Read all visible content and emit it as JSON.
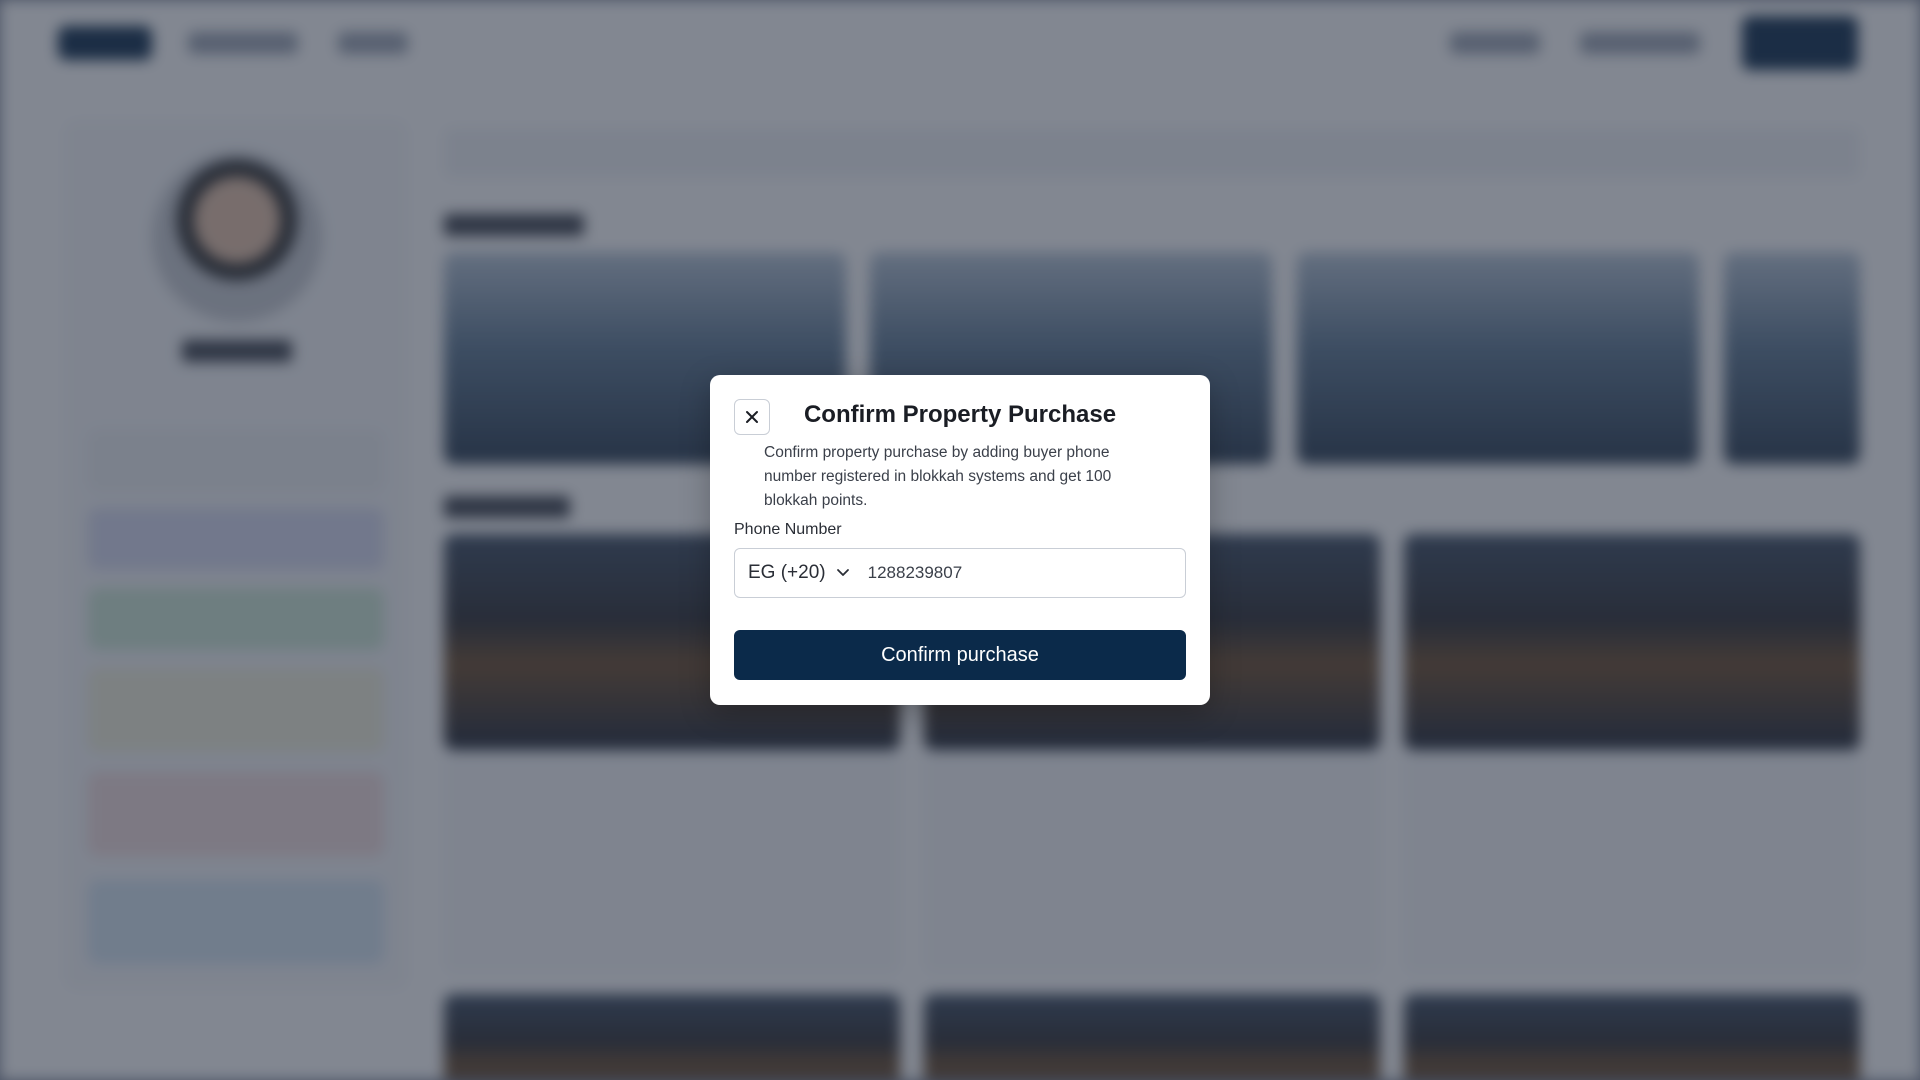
{
  "modal": {
    "title": "Confirm Property Purchase",
    "description": "Confirm property purchase by adding buyer phone number registered in blokkah systems and get 100  blokkah points.",
    "close_icon": "close-icon",
    "phone": {
      "label": "Phone Number",
      "country_code": "EG (+20)",
      "value": "1288239807",
      "dropdown_icon": "chevron-down-icon"
    },
    "confirm_label": "Confirm purchase"
  },
  "colors": {
    "primary": "#0b2a4a",
    "overlay": "#7d8597"
  }
}
